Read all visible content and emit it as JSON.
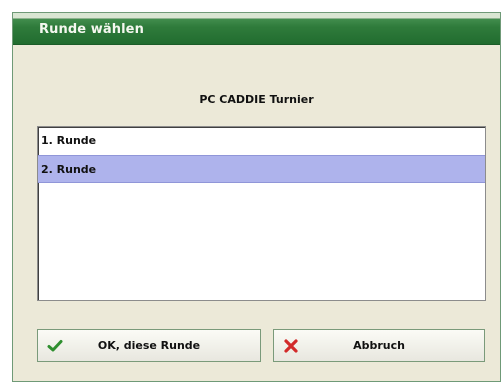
{
  "dialog": {
    "title": "Runde wählen",
    "tournament": "PC CADDIE Turnier",
    "rounds": [
      {
        "label": "1. Runde",
        "selected": false
      },
      {
        "label": "2. Runde",
        "selected": true
      }
    ],
    "buttons": {
      "ok_label": "OK, diese Runde",
      "ok_icon": "check-icon",
      "cancel_label": "Abbruch",
      "cancel_icon": "x-icon"
    },
    "colors": {
      "titlebar": "#2f7b3b",
      "selection": "#aeb3ec",
      "ok_icon": "#2f8f2f",
      "cancel_icon": "#d22a2a"
    }
  }
}
